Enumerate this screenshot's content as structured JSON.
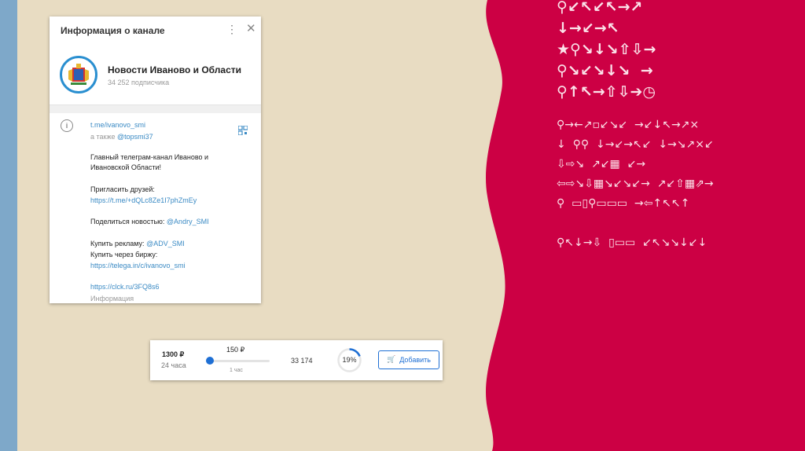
{
  "colors": {
    "red": "#cc0044",
    "cream": "#e8dcc2",
    "blue_bar": "#7ea8c9",
    "accent": "#1e6fd4",
    "link": "#3a8ac4"
  },
  "channel_info": {
    "title": "Информация о канале",
    "menu_icon": "⋮",
    "close_icon": "✕",
    "avatar_icon": "coat-of-arms",
    "channel_name": "Новости Иваново и Области",
    "subscribers": "34 252 подписчика",
    "info_icon": "i",
    "link": "t.me/ivanovo_smi",
    "also_label": "а также ",
    "also_handle": "@topsmi37",
    "description_1": "Главный телеграм-канал Иваново и",
    "description_2": "Ивановской Области!",
    "invite_label": "Пригласить друзей:",
    "invite_link": "https://t.me/+dQLc8Ze1I7phZmEy",
    "news_label": "Поделиться новостью: ",
    "news_handle": "@Andry_SMI",
    "ads_label": "Купить рекламу: ",
    "ads_handle": "@ADV_SMI",
    "exchange_label": "Купить через биржу:",
    "exchange_link": "https://telega.in/c/ivanovo_smi",
    "clck_link": "https://clck.ru/3FQ8s6",
    "footer_label": "Информация"
  },
  "ad_bar": {
    "price": "1300 ₽",
    "duration": "24 часа",
    "slider_price": "150 ₽",
    "slider_sub": "1 час",
    "slider_value_fraction": 0,
    "count": "33 174",
    "percent_label": "19%",
    "percent_value": 19,
    "add_button": "Добавить",
    "cart_icon": "🛒"
  },
  "garbled_text": {
    "big_lines": [
      "⚲↙↖↙↖→↗",
      "↓→↙→↖",
      "★⚲↘↓↘⇧⇩→",
      "⚲↘↙↘↓↘  →",
      "⚲↑↖→⇧⇩➔◷"
    ],
    "small_lines": [
      "⚲→←↗▫↙↘↙  →↙↓↖→↗×",
      "↓  ⚲⚲  ↓→↙→↖↙  ↓→↘↗×↙",
      "⇩⇨↘  ↗↙▦  ↙→",
      "⇦⇨↘⇩▦↘↙↘↙→  ↗↙⇧▦⇗→",
      "⚲  ▭▯⚲▭▭▭  →⇦↑↖↖↑",
      "",
      "⚲↖↓→⇩  ▯▭▭  ↙↖↘↘↓↙↓"
    ]
  }
}
